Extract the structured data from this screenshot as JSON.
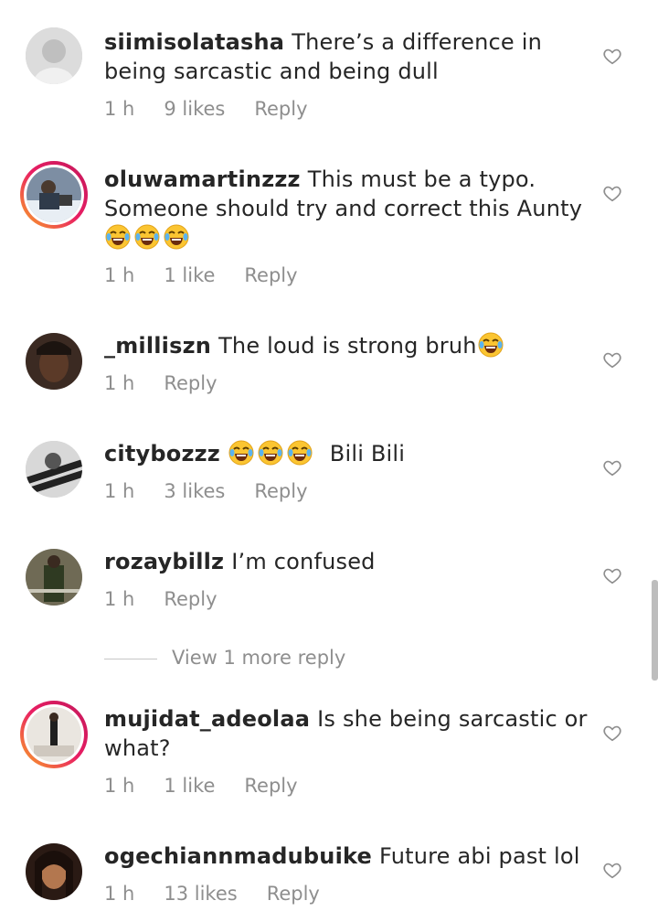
{
  "comments": [
    {
      "username": "siimisolatasha",
      "text": "There’s a difference in being sarcastic and being dull",
      "time": "1 h",
      "likes": "9 likes",
      "reply": "Reply",
      "emoji_count": 0,
      "story_ring": false
    },
    {
      "username": "oluwamartinzzz",
      "text": "This must be a typo. Someone should try and correct this Aunty",
      "time": "1 h",
      "likes": "1 like",
      "reply": "Reply",
      "emoji_count": 3,
      "story_ring": true
    },
    {
      "username": "_milliszn",
      "text": "The loud is strong bruh",
      "time": "1 h",
      "likes": "",
      "reply": "Reply",
      "emoji_count": 1,
      "story_ring": false
    },
    {
      "username": "citybozzz",
      "text": "Bili Bili",
      "time": "1 h",
      "likes": "3 likes",
      "reply": "Reply",
      "emoji_count": 3,
      "story_ring": false
    },
    {
      "username": "rozaybillz",
      "text": "I’m confused",
      "time": "1 h",
      "likes": "",
      "reply": "Reply",
      "emoji_count": 0,
      "story_ring": false
    },
    {
      "username": "mujidat_adeolaa",
      "text": "Is she being sarcastic or what?",
      "time": "1 h",
      "likes": "1 like",
      "reply": "Reply",
      "emoji_count": 0,
      "story_ring": true
    },
    {
      "username": "ogechiannmadubuike",
      "text": "Future abi past lol",
      "time": "1 h",
      "likes": "13 likes",
      "reply": "Reply",
      "emoji_count": 0,
      "story_ring": false
    }
  ],
  "view_more": "View 1 more reply",
  "icons": {
    "like": "heart-outline-icon",
    "emoji": "face-with-tears-of-joy-emoji"
  },
  "colors": {
    "text": "#262626",
    "meta": "#8e8e8e",
    "ring_start": "#f9a825",
    "ring_end": "#c2185b"
  }
}
